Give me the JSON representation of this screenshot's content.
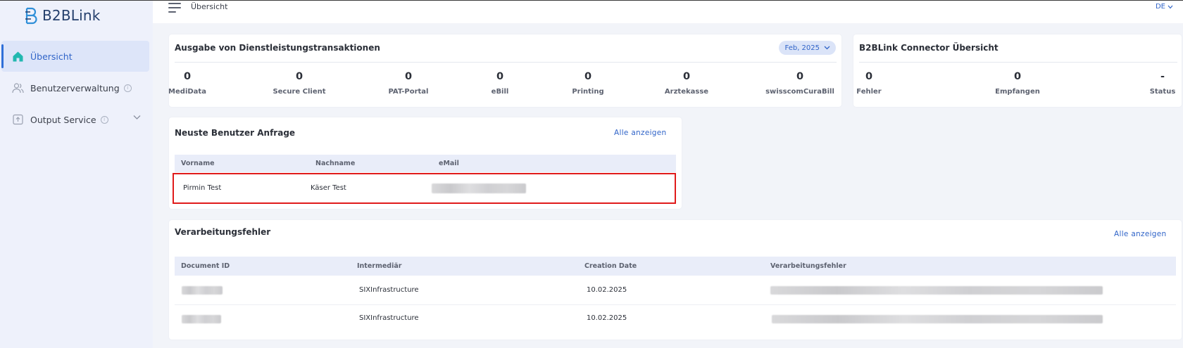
{
  "app": {
    "name": "B2BLink"
  },
  "topbar": {
    "title": "Übersicht",
    "language": "DE"
  },
  "sidebar": {
    "items": [
      {
        "label": "Übersicht",
        "icon": "home-icon",
        "active": true
      },
      {
        "label": "Benutzerverwaltung",
        "icon": "users-icon",
        "active": false
      },
      {
        "label": "Output Service",
        "icon": "upload-icon",
        "active": false
      }
    ]
  },
  "transactions": {
    "title": "Ausgabe von Dienstleistungstransaktionen",
    "month": "Feb, 2025",
    "stats": [
      {
        "value": "0",
        "label": "MediData"
      },
      {
        "value": "0",
        "label": "Secure Client"
      },
      {
        "value": "0",
        "label": "PAT-Portal"
      },
      {
        "value": "0",
        "label": "eBill"
      },
      {
        "value": "0",
        "label": "Printing"
      },
      {
        "value": "0",
        "label": "Arztekasse"
      },
      {
        "value": "0",
        "label": "swisscomCuraBill"
      }
    ]
  },
  "connector": {
    "title": "B2BLink Connector Übersicht",
    "stats": [
      {
        "value": "0",
        "label": "Fehler"
      },
      {
        "value": "0",
        "label": "Empfangen"
      },
      {
        "value": "-",
        "label": "Status"
      }
    ]
  },
  "user_requests": {
    "title": "Neuste Benutzer Anfrage",
    "show_all": "Alle anzeigen",
    "columns": [
      "Vorname",
      "Nachname",
      "eMail"
    ],
    "rows": [
      {
        "first": "Pirmin Test",
        "last": "Käser Test"
      }
    ]
  },
  "errors": {
    "title": "Verarbeitungsfehler",
    "show_all": "Alle anzeigen",
    "columns": [
      "Document ID",
      "Intermediär",
      "Creation Date",
      "Verarbeitungsfehler"
    ],
    "rows": [
      {
        "intermediary": "SIXInfrastructure",
        "date": "10.02.2025"
      },
      {
        "intermediary": "SIXInfrastructure",
        "date": "10.02.2025"
      }
    ]
  },
  "colors": {
    "accent": "#3064c8",
    "highlight": "#e01b1b",
    "sidebar_bg": "#eef1fb"
  }
}
